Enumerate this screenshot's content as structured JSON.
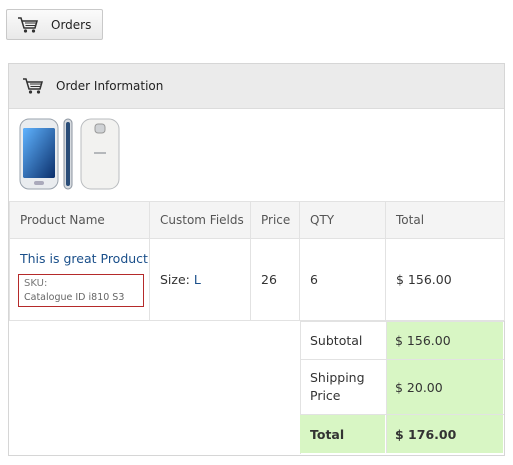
{
  "orders_button": {
    "label": "Orders",
    "icon": "cart-icon"
  },
  "panel": {
    "title": "Order Information",
    "icon": "cart-icon"
  },
  "table": {
    "headers": [
      "Product Name",
      "Custom Fields",
      "Price",
      "QTY",
      "Total"
    ],
    "row": {
      "product_name": "This is great Product",
      "sku_label": "SKU:",
      "sku_value": "Catalogue ID i810 S3",
      "custom_field_label": "Size:",
      "custom_field_value": "L",
      "price": "26",
      "qty": "6",
      "total": "$ 156.00"
    }
  },
  "totals": {
    "subtotal_label": "Subtotal",
    "subtotal_value": "$ 156.00",
    "shipping_label": "Shipping Price",
    "shipping_value": "$ 20.00",
    "total_label": "Total",
    "total_value": "$ 176.00"
  },
  "colors": {
    "highlight": "#d8f6c4",
    "link": "#1a4f8a",
    "sku_border": "#b52a2a"
  }
}
